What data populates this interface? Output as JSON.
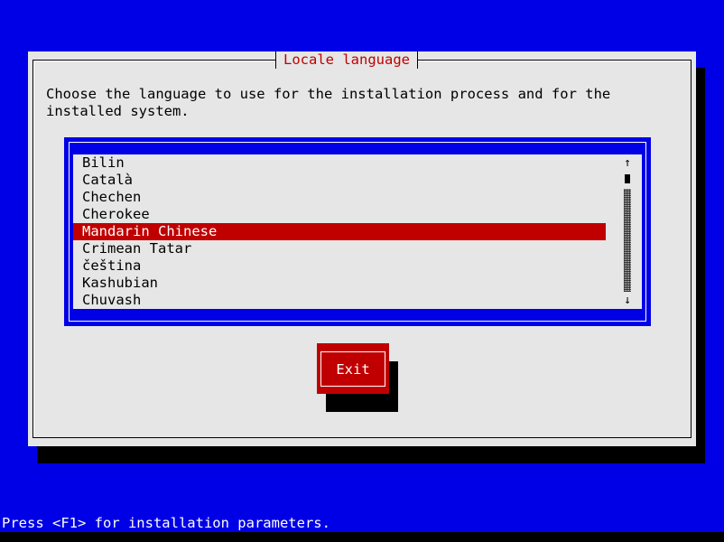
{
  "dialog": {
    "title": "Locale language",
    "prompt": "Choose the language to use for the installation process and for the\ninstalled system."
  },
  "language_list": {
    "items": [
      {
        "label": "Bilin",
        "selected": false
      },
      {
        "label": "Català",
        "selected": false
      },
      {
        "label": "Chechen",
        "selected": false
      },
      {
        "label": "Cherokee",
        "selected": false
      },
      {
        "label": "Mandarin Chinese",
        "selected": true
      },
      {
        "label": "Crimean Tatar",
        "selected": false
      },
      {
        "label": "čeština",
        "selected": false
      },
      {
        "label": "Kashubian",
        "selected": false
      },
      {
        "label": "Chuvash",
        "selected": false
      }
    ],
    "scroll_up": "↑",
    "scroll_down": "↓"
  },
  "buttons": {
    "exit_label": "Exit"
  },
  "status_bar": {
    "text": "Press <F1> for installation parameters."
  },
  "colors": {
    "background": "#0000e6",
    "dialog": "#e6e6e6",
    "accent": "#c00000"
  }
}
